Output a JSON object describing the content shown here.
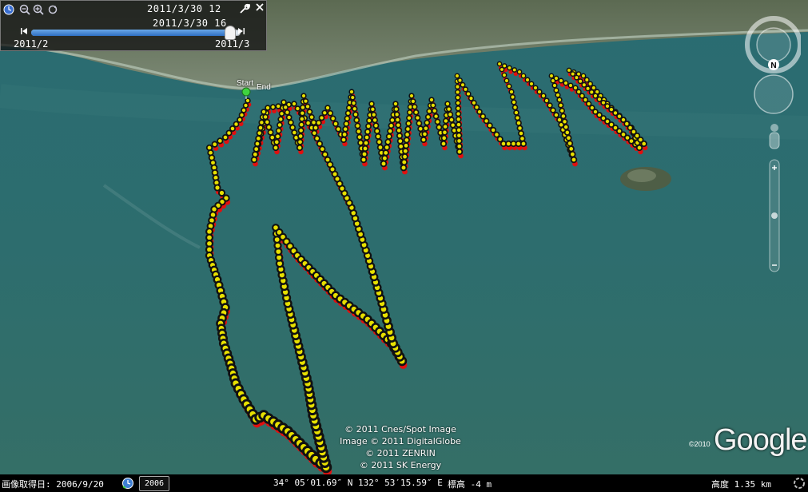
{
  "time_slider": {
    "time_start": "2011/3/30 12",
    "time_end": "2011/3/30 16",
    "range_start": "2011/2",
    "range_end": "2011/3",
    "position_fraction": 0.95
  },
  "toolbar_icons": [
    "clock-icon",
    "zoom-out-icon",
    "zoom-in-icon",
    "reset-icon",
    "settings-icon",
    "close-icon"
  ],
  "track": {
    "start_label": "Start",
    "end_label": "End",
    "point_color": "#e8e000",
    "shadow_color": "#e01010"
  },
  "copyright_lines": [
    "© 2011 Cnes/Spot Image",
    "Image © 2011 DigitalGlobe",
    "© 2011 ZENRIN",
    "© 2011 SK Energy"
  ],
  "brand": {
    "logo": "Google",
    "year": "©2010"
  },
  "navigation": {
    "north_label": "N"
  },
  "status_bar": {
    "imagery_date": "画像取得日: 2006/9/20",
    "history_year": "2006",
    "coordinates": "34° 05′01.69″ N 132° 53′15.59″ E",
    "elevation": "標高  -4 m",
    "altitude": "高度    1.35 km"
  }
}
